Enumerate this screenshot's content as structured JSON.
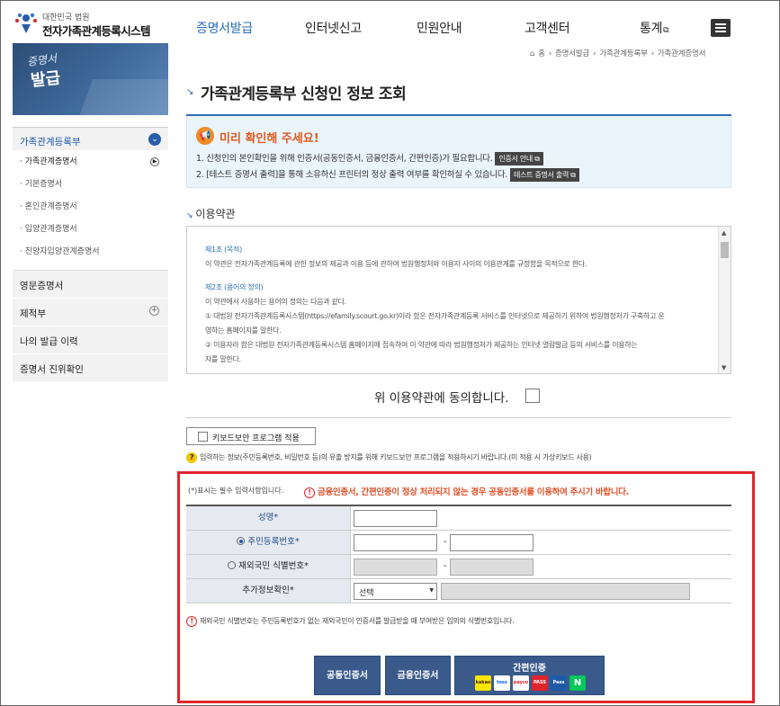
{
  "header": {
    "logo_small": "대한민국 법원",
    "logo_big": "전자가족관계등록시스템",
    "nav": [
      "증명서발급",
      "인터넷신고",
      "민원안내",
      "고객센터",
      "통계"
    ],
    "ext_icon": "external-link-icon"
  },
  "visual": {
    "line1": "증명서",
    "line2": "발급"
  },
  "sidebar": {
    "head": "가족관계등록부",
    "sub": [
      "· 가족관계증명서",
      "· 기본증명서",
      "· 혼인관계증명서",
      "· 입양관계증명서",
      "· 친양자입양관계증명서"
    ],
    "items": [
      "영문증명서",
      "제적부",
      "나의 발급 이력",
      "증명서 진위확인"
    ]
  },
  "breadcrumb": [
    "홈",
    "증명서발급",
    "가족관계등록부",
    "가족관계증명서"
  ],
  "page_title": "가족관계등록부 신청인 정보 조회",
  "notice": {
    "heading": "미리 확인해 주세요!",
    "line1": "1. 신청인의 본인확인을 위해 인증서(공동인증서, 금융인증서, 간편인증)가 필요합니다.",
    "line1_tag": "인증서 안내",
    "line2": "2. [테스트 증명서 출력]을 통해 소유하신 프린터의 정상 출력 여부를 확인하실 수 있습니다.",
    "line2_tag": "테스트 증명서 출력"
  },
  "terms": {
    "title": "이용약관",
    "art1_title": "제1조 (목적)",
    "art1_text": "이 약관은 전자가족관계등록에 관한 정보의 제공과 이용 등에 관하여 법원행정처와 이용자 사이의 이용관계를 규정함을 목적으로 한다.",
    "art2_title": "제2조 (용어의 정의)",
    "art2_text": "이 약관에서 사용하는 용어의 정의는 다음과 같다.",
    "art2_item1": "① 대법원 전자가족관계등록시스템(https://efamily.scourt.go.kr)이라 함은 전자가족관계등록 서비스를 인터넷으로 제공하기 위하여 법원행정처가 구축하고 운",
    "art2_item1b": "영하는 홈페이지를 말한다.",
    "art2_item2": "② 이용자라 함은 대법원 전자가족관계등록시스템 홈페이지에 접속하여 이 약관에 따라 법원행정처가 제공하는 인터넷 열람발급 등의 서비스를 이용하는",
    "art2_item2b": "자를 말한다.",
    "agree_label": "위 이용약관에 동의합니다."
  },
  "keyboard": {
    "button": "키보드보안 프로그램 적용",
    "note": "입력하는 정보(주민등록번호, 비밀번호 등)의 유출 방지를 위해 키보드보안 프로그램을 적용하시기 바랍니다.(미 적용 시 가상키보드 사용)"
  },
  "form": {
    "required_note": "(*)표시는 필수 입력사항입니다.",
    "warning": "금융인증서, 간편인증이 정상 처리되지 않는 경우 공동인증서를 이용하여 주시기 바랍니다.",
    "name_label": "성명",
    "rrn_label": "주민등록번호",
    "foreign_label": "재외국민 식별번호",
    "extra_label": "추가정보확인",
    "required_mark": "*",
    "dash": "-",
    "select_value": "선택",
    "foot_note": "재외국민 식별번호는 주민등록번호가 없는 재외국민이 인증서를 발급받을 때 부여받은 임의의 식별번호입니다."
  },
  "buttons": {
    "joint": "공동인증서",
    "financial": "금융인증서",
    "simple": "간편인증",
    "providers": [
      "kakao",
      "toss",
      "payco",
      "PASS",
      "Pass",
      "N"
    ]
  },
  "colors": {
    "accent": "#2a6fb6",
    "alert": "#e0242c",
    "button": "#3a5a8c"
  }
}
